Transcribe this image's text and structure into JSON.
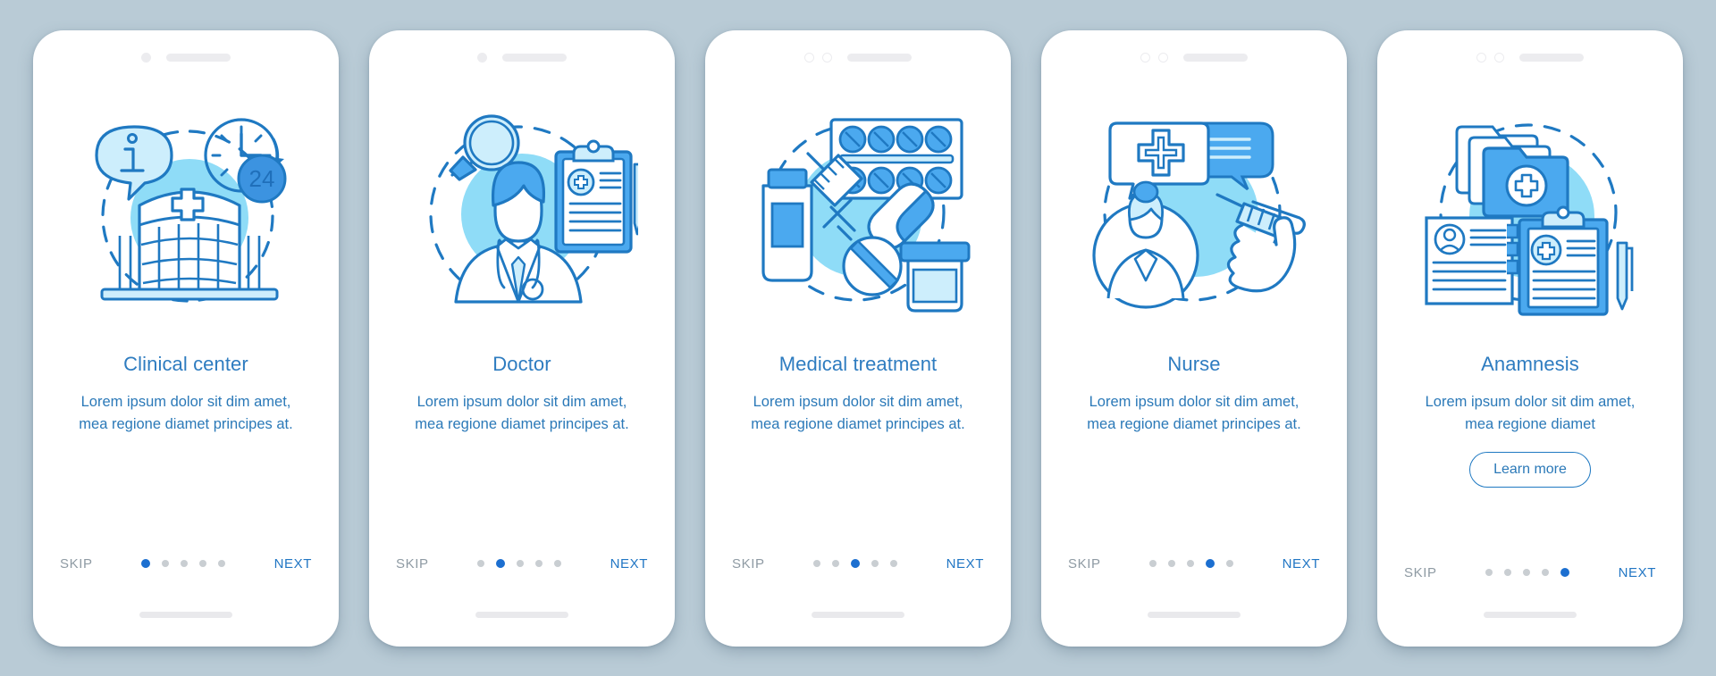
{
  "theme": {
    "page_background": "#b9cbd6",
    "card_background": "#ffffff",
    "title_color": "#2e7cc0",
    "body_color": "#2b79b8",
    "skip_color": "#8e9aa3",
    "next_color": "#2176c4",
    "dot_inactive": "#c9ced2",
    "dot_active": "#1c6fd0",
    "accent_line": "#1f79c2",
    "accent_fill_light": "#8fdcf7",
    "accent_fill_mid": "#4ba9ef"
  },
  "nav_labels": {
    "skip": "SKIP",
    "next": "NEXT"
  },
  "body_text": "Lorem ipsum dolor sit dim amet, mea regione diamet principes at.",
  "screens": [
    {
      "id": "clinical-center",
      "title": "Clinical center",
      "body": "Lorem ipsum dolor sit dim amet, mea regione diamet principes at.",
      "illustration": "clinical-center-illustration",
      "illustration_labels": [
        "i",
        "24"
      ],
      "active_dot": 1,
      "total_dots": 5,
      "camera_style": "single-dot",
      "cta": null
    },
    {
      "id": "doctor",
      "title": "Doctor",
      "body": "Lorem ipsum dolor sit dim amet, mea regione diamet principes at.",
      "illustration": "doctor-illustration",
      "illustration_labels": [],
      "active_dot": 2,
      "total_dots": 5,
      "camera_style": "single-dot",
      "cta": null
    },
    {
      "id": "medical-treatment",
      "title": "Medical treatment",
      "body": "Lorem ipsum dolor sit dim amet, mea regione diamet principes at.",
      "illustration": "medical-treatment-illustration",
      "illustration_labels": [],
      "active_dot": 3,
      "total_dots": 5,
      "camera_style": "double-ring",
      "cta": null
    },
    {
      "id": "nurse",
      "title": "Nurse",
      "body": "Lorem ipsum dolor sit dim amet, mea regione diamet principes at.",
      "illustration": "nurse-illustration",
      "illustration_labels": [],
      "active_dot": 4,
      "total_dots": 5,
      "camera_style": "double-ring",
      "cta": null
    },
    {
      "id": "anamnesis",
      "title": "Anamnesis",
      "body": "Lorem ipsum dolor sit dim amet, mea regione diamet",
      "illustration": "anamnesis-illustration",
      "illustration_labels": [],
      "active_dot": 5,
      "total_dots": 5,
      "camera_style": "double-ring",
      "cta": "Learn more"
    }
  ]
}
